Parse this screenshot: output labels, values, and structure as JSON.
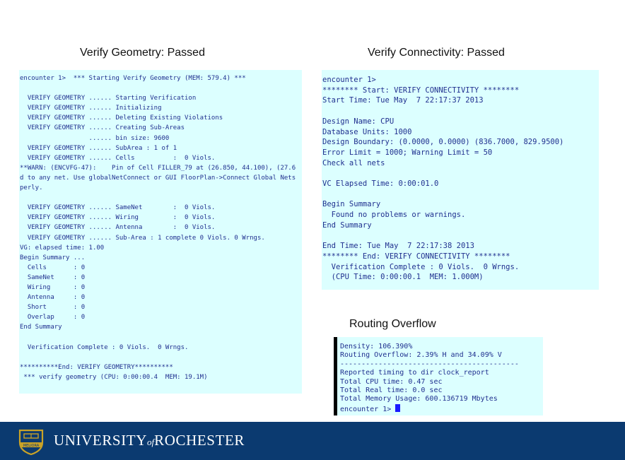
{
  "headings": {
    "geometry": "Verify Geometry: Passed",
    "connectivity": "Verify Connectivity: Passed",
    "routing": "Routing Overflow"
  },
  "geometry_log": [
    "encounter 1>  *** Starting Verify Geometry (MEM: 579.4) ***",
    "",
    "  VERIFY GEOMETRY ...... Starting Verification",
    "  VERIFY GEOMETRY ...... Initializing",
    "  VERIFY GEOMETRY ...... Deleting Existing Violations",
    "  VERIFY GEOMETRY ...... Creating Sub-Areas",
    "                  ...... bin size: 9600",
    "  VERIFY GEOMETRY ...... SubArea : 1 of 1",
    "  VERIFY GEOMETRY ...... Cells          :  0 Viols.",
    "**WARN: (ENCVFG-47):    Pin of Cell FILLER_79 at (26.850, 44.100), (27.6",
    "d to any net. Use globalNetConnect or GUI FloorPlan->Connect Global Nets",
    "perly.",
    "",
    "  VERIFY GEOMETRY ...... SameNet        :  0 Viols.",
    "  VERIFY GEOMETRY ...... Wiring         :  0 Viols.",
    "  VERIFY GEOMETRY ...... Antenna        :  0 Viols.",
    "  VERIFY GEOMETRY ...... Sub-Area : 1 complete 0 Viols. 0 Wrngs.",
    "VG: elapsed time: 1.00",
    "Begin Summary ...",
    "  Cells       : 0",
    "  SameNet     : 0",
    "  Wiring      : 0",
    "  Antenna     : 0",
    "  Short       : 0",
    "  Overlap     : 0",
    "End Summary",
    "",
    "  Verification Complete : 0 Viols.  0 Wrngs.",
    "",
    "**********End: VERIFY GEOMETRY**********",
    " *** verify geometry (CPU: 0:00:00.4  MEM: 19.1M)"
  ],
  "connectivity_log": [
    "encounter 1>",
    "******** Start: VERIFY CONNECTIVITY ********",
    "Start Time: Tue May  7 22:17:37 2013",
    "",
    "Design Name: CPU",
    "Database Units: 1000",
    "Design Boundary: (0.0000, 0.0000) (836.7000, 829.9500)",
    "Error Limit = 1000; Warning Limit = 50",
    "Check all nets",
    "",
    "VC Elapsed Time: 0:00:01.0",
    "",
    "Begin Summary",
    "  Found no problems or warnings.",
    "End Summary",
    "",
    "End Time: Tue May  7 22:17:38 2013",
    "******** End: VERIFY CONNECTIVITY ********",
    "  Verification Complete : 0 Viols.  0 Wrngs.",
    "  (CPU Time: 0:00:00.1  MEM: 1.000M)"
  ],
  "routing_log": [
    "Density: 106.390%",
    "Routing Overflow: 2.39% H and 34.09% V",
    "------------------------------------------",
    "Reported timing to dir clock_report",
    "Total CPU time: 0.47 sec",
    "Total Real time: 0.0 sec",
    "Total Memory Usage: 600.136719 Mbytes"
  ],
  "routing_prompt": "encounter 1> ",
  "footer": {
    "university": "UNIVERSITY",
    "of": "of",
    "rochester": "ROCHESTER",
    "seal_text": "MELIORA"
  },
  "colors": {
    "terminal_bg": "#dcffff",
    "terminal_text": "#1f2f8f",
    "footer_bg": "#0b3a70",
    "seal_gold": "#c9a227"
  }
}
